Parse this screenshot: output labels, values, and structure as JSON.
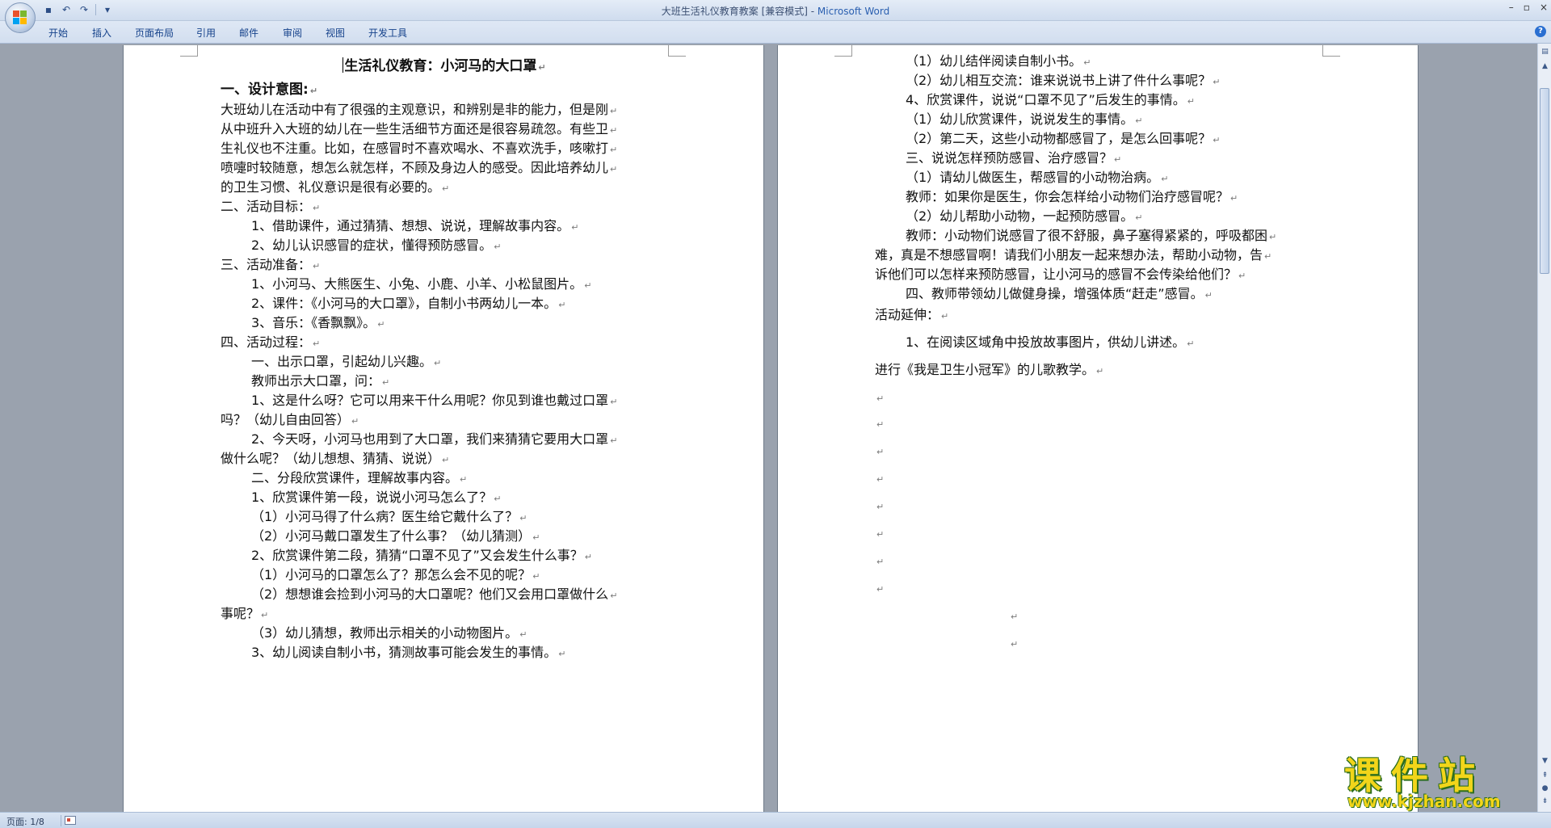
{
  "window": {
    "title_doc": "大班生活礼仪教育教案 [兼容模式] - ",
    "title_app": "Microsoft Word"
  },
  "quick_access": {
    "save_icon": "save-icon",
    "undo_icon": "undo-icon",
    "redo_icon": "redo-icon",
    "customize_icon": "customize-icon"
  },
  "tabs": [
    "开始",
    "插入",
    "页面布局",
    "引用",
    "邮件",
    "审阅",
    "视图",
    "开发工具"
  ],
  "status": {
    "page": "页面: 1/8"
  },
  "watermark": {
    "big": "课件站",
    "small": "www.kjzhan.com"
  },
  "page1": [
    {
      "text": "生活礼仪教育：小河马的大口罩",
      "style": "title"
    },
    {
      "text": "一、设计意图:",
      "style": "head"
    },
    {
      "text": "大班幼儿在活动中有了很强的主观意识，和辨别是非的能力，但是刚"
    },
    {
      "text": "从中班升入大班的幼儿在一些生活细节方面还是很容易疏忽。有些卫"
    },
    {
      "text": "生礼仪也不注重。比如，在感冒时不喜欢喝水、不喜欢洗手，咳嗽打"
    },
    {
      "text": "喷嚏时较随意，想怎么就怎样，不顾及身边人的感受。因此培养幼儿"
    },
    {
      "text": "的卫生习惯、礼仪意识是很有必要的。"
    },
    {
      "text": "二、活动目标："
    },
    {
      "text": "1、借助课件，通过猜猜、想想、说说，理解故事内容。",
      "indent": 1
    },
    {
      "text": "2、幼儿认识感冒的症状，懂得预防感冒。",
      "indent": 1
    },
    {
      "text": "三、活动准备："
    },
    {
      "text": "1、小河马、大熊医生、小兔、小鹿、小羊、小松鼠图片。",
      "indent": 1
    },
    {
      "text": "2、课件：《小河马的大口罩》，自制小书两幼儿一本。",
      "indent": 1
    },
    {
      "text": "3、音乐：《香飘飘》。",
      "indent": 1
    },
    {
      "text": "四、活动过程："
    },
    {
      "text": "一、出示口罩，引起幼儿兴趣。",
      "indent": 1
    },
    {
      "text": "教师出示大口罩，问：",
      "indent": 1
    },
    {
      "text": "1、这是什么呀？它可以用来干什么用呢？你见到谁也戴过口罩",
      "indent": 1
    },
    {
      "text": "吗？（幼儿自由回答）"
    },
    {
      "text": "2、今天呀，小河马也用到了大口罩，我们来猜猜它要用大口罩",
      "indent": 1
    },
    {
      "text": "做什么呢？（幼儿想想、猜猜、说说）"
    },
    {
      "text": "二、分段欣赏课件，理解故事内容。",
      "indent": 1
    },
    {
      "text": "1、欣赏课件第一段，说说小河马怎么了？",
      "indent": 1
    },
    {
      "text": "（1）小河马得了什么病？医生给它戴什么了？",
      "indent": 1
    },
    {
      "text": "（2）小河马戴口罩发生了什么事？（幼儿猜测）",
      "indent": 1
    },
    {
      "text": "2、欣赏课件第二段，猜猜“口罩不见了”又会发生什么事？",
      "indent": 1
    },
    {
      "text": "（1）小河马的口罩怎么了？那怎么会不见的呢？",
      "indent": 1
    },
    {
      "text": "（2）想想谁会捡到小河马的大口罩呢？他们又会用口罩做什么",
      "indent": 1
    },
    {
      "text": "事呢？"
    },
    {
      "text": "（3）幼儿猜想，教师出示相关的小动物图片。",
      "indent": 1
    },
    {
      "text": "3、幼儿阅读自制小书，猜测故事可能会发生的事情。",
      "indent": 1
    }
  ],
  "page2": [
    {
      "text": "（1）幼儿结伴阅读自制小书。",
      "indent": 1
    },
    {
      "text": "（2）幼儿相互交流：谁来说说书上讲了件什么事呢？",
      "indent": 1
    },
    {
      "text": "4、欣赏课件，说说“口罩不见了”后发生的事情。",
      "indent": 1
    },
    {
      "text": "（1）幼儿欣赏课件，说说发生的事情。",
      "indent": 1
    },
    {
      "text": "（2）第二天，这些小动物都感冒了，是怎么回事呢？",
      "indent": 1
    },
    {
      "text": "三、说说怎样预防感冒、治疗感冒？",
      "indent": 1
    },
    {
      "text": "（1）请幼儿做医生，帮感冒的小动物治病。",
      "indent": 1
    },
    {
      "text": "教师：如果你是医生，你会怎样给小动物们治疗感冒呢？",
      "indent": 1
    },
    {
      "text": "（2）幼儿帮助小动物，一起预防感冒。",
      "indent": 1
    },
    {
      "text": "教师：小动物们说感冒了很不舒服，鼻子塞得紧紧的，呼吸都困",
      "indent": 1
    },
    {
      "text": "难，真是不想感冒啊！请我们小朋友一起来想办法，帮助小动物，告"
    },
    {
      "text": "诉他们可以怎样来预防感冒，让小河马的感冒不会传染给他们？"
    },
    {
      "text": "四、教师带领幼儿做健身操，增强体质“赶走”感冒。",
      "indent": 1
    },
    {
      "text": "活动延伸："
    },
    {
      "text": "1、在阅读区域角中投放故事图片，供幼儿讲述。",
      "indent": 1
    },
    {
      "text": "进行《我是卫生小冠军》的儿歌教学。"
    }
  ]
}
